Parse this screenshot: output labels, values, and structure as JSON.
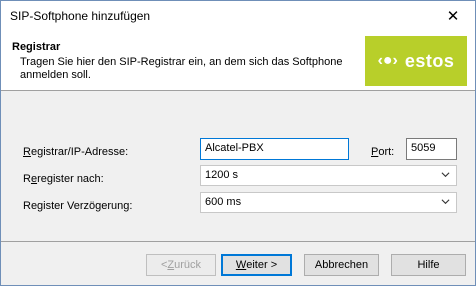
{
  "window": {
    "title": "SIP-Softphone hinzufügen",
    "close_glyph": "✕"
  },
  "header": {
    "title": "Registrar",
    "description": "Tragen Sie hier den SIP-Registrar ein, an dem sich das Softphone anmelden soll.",
    "logo_symbol": "‹●›",
    "logo_text": "estos"
  },
  "form": {
    "registrar_label_mnemonic": "R",
    "registrar_label_rest": "egistrar/IP-Adresse:",
    "registrar_value": "Alcatel-PBX",
    "port_label_mnemonic": "P",
    "port_label_rest": "ort:",
    "port_value": "5059",
    "reregister_label_first": "R",
    "reregister_label_mnemonic": "e",
    "reregister_label_rest": "register nach:",
    "reregister_value": "1200 s",
    "delay_label": "Register Verzögerung:",
    "delay_value": "600 ms"
  },
  "buttons": {
    "back_prefix": "< ",
    "back_mnemonic": "Z",
    "back_rest": "urück",
    "next_mnemonic": "W",
    "next_rest": "eiter >",
    "cancel": "Abbrechen",
    "help": "Hilfe"
  },
  "colors": {
    "accent": "#0078d7",
    "brand": "#b8cf2a"
  }
}
